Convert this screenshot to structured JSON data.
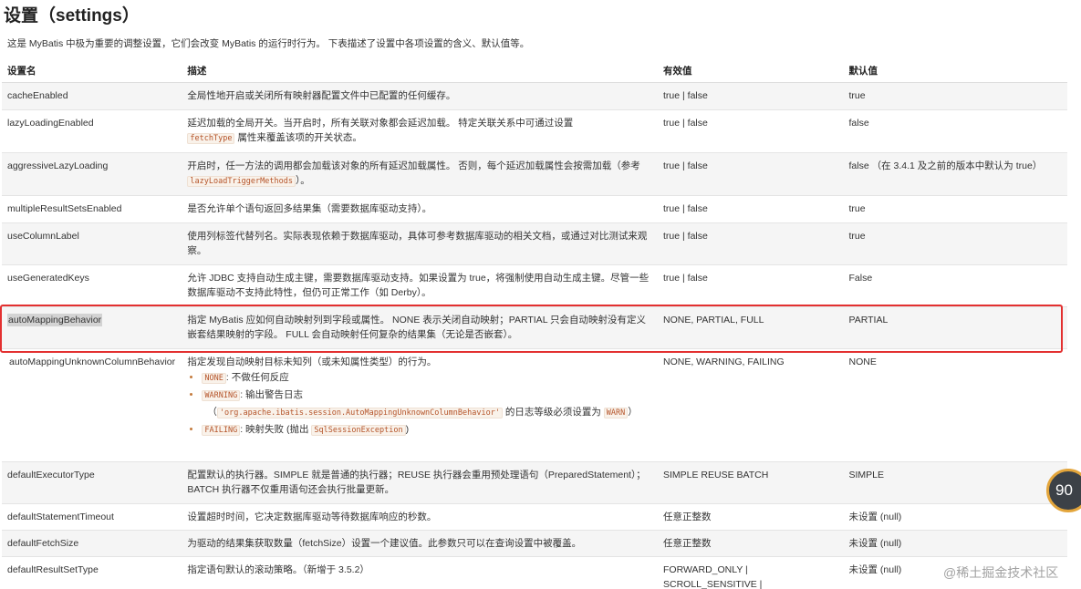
{
  "page": {
    "title": "设置（settings）",
    "intro": "这是 MyBatis 中极为重要的调整设置，它们会改变 MyBatis 的运行时行为。 下表描述了设置中各项设置的含义、默认值等。"
  },
  "table": {
    "headers": {
      "name": "设置名",
      "description": "描述",
      "valid_values": "有效值",
      "default": "默认值"
    },
    "rows": [
      {
        "name": "cacheEnabled",
        "description": "全局性地开启或关闭所有映射器配置文件中已配置的任何缓存。",
        "valid_values": "true | false",
        "default": "true"
      },
      {
        "name": "lazyLoadingEnabled",
        "description_a": "延迟加载的全局开关。当开启时，所有关联对象都会延迟加载。 特定关联关系中可通过设置",
        "description_code": "fetchType",
        "description_b": "属性来覆盖该项的开关状态。",
        "valid_values": "true | false",
        "default": "false"
      },
      {
        "name": "aggressiveLazyLoading",
        "description_a": "开启时，任一方法的调用都会加载该对象的所有延迟加载属性。 否则，每个延迟加载属性会按需加载（参考",
        "description_code": "lazyLoadTriggerMethods",
        "description_b": "）。",
        "valid_values": "true | false",
        "default": "false （在 3.4.1 及之前的版本中默认为 true）"
      },
      {
        "name": "multipleResultSetsEnabled",
        "description": "是否允许单个语句返回多结果集（需要数据库驱动支持）。",
        "valid_values": "true | false",
        "default": "true"
      },
      {
        "name": "useColumnLabel",
        "description": "使用列标签代替列名。实际表现依赖于数据库驱动，具体可参考数据库驱动的相关文档，或通过对比测试来观察。",
        "valid_values": "true | false",
        "default": "true"
      },
      {
        "name": "useGeneratedKeys",
        "description": "允许 JDBC 支持自动生成主键，需要数据库驱动支持。如果设置为 true，将强制使用自动生成主键。尽管一些数据库驱动不支持此特性，但仍可正常工作（如 Derby）。",
        "valid_values": "true | false",
        "default": "False"
      },
      {
        "name": "autoMappingBehavior",
        "description": "指定 MyBatis 应如何自动映射列到字段或属性。 NONE 表示关闭自动映射；PARTIAL 只会自动映射没有定义嵌套结果映射的字段。 FULL 会自动映射任何复杂的结果集（无论是否嵌套）。",
        "valid_values": "NONE, PARTIAL, FULL",
        "default": "PARTIAL"
      },
      {
        "name": "autoMappingUnknownColumnBehavior",
        "description_intro": "指定发现自动映射目标未知列（或未知属性类型）的行为。",
        "items": [
          {
            "code": "NONE",
            "text": ": 不做任何反应"
          },
          {
            "code": "WARNING",
            "text": ": 输出警告日志",
            "line2_pre": "（",
            "line2_code": "'org.apache.ibatis.session.AutoMappingUnknownColumnBehavior'",
            "line2_post": " 的日志等级必须设置为 ",
            "line2_code2": "WARN",
            "line2_end": "）"
          },
          {
            "code": "FAILING",
            "text": ": 映射失败 (抛出 ",
            "code2": "SqlSessionException",
            "end": ")"
          }
        ],
        "valid_values": "NONE, WARNING, FAILING",
        "default": "NONE"
      },
      {
        "name": "defaultExecutorType",
        "description": "配置默认的执行器。SIMPLE 就是普通的执行器；REUSE 执行器会重用预处理语句（PreparedStatement）； BATCH 执行器不仅重用语句还会执行批量更新。",
        "valid_values": "SIMPLE REUSE BATCH",
        "default": "SIMPLE"
      },
      {
        "name": "defaultStatementTimeout",
        "description": "设置超时时间，它决定数据库驱动等待数据库响应的秒数。",
        "valid_values": "任意正整数",
        "default": "未设置 (null)"
      },
      {
        "name": "defaultFetchSize",
        "description": "为驱动的结果集获取数量（fetchSize）设置一个建议值。此参数只可以在查询设置中被覆盖。",
        "valid_values": "任意正整数",
        "default": "未设置 (null)"
      },
      {
        "name": "defaultResultSetType",
        "description": "指定语句默认的滚动策略。（新增于 3.5.2）",
        "valid_values_line1": "FORWARD_ONLY |",
        "valid_values_line2": "SCROLL_SENSITIVE |",
        "default": "未设置 (null)"
      }
    ]
  },
  "overlay": {
    "badge_text": "90",
    "watermark": "@稀土掘金技术社区",
    "highlight_color": "#e33030"
  }
}
